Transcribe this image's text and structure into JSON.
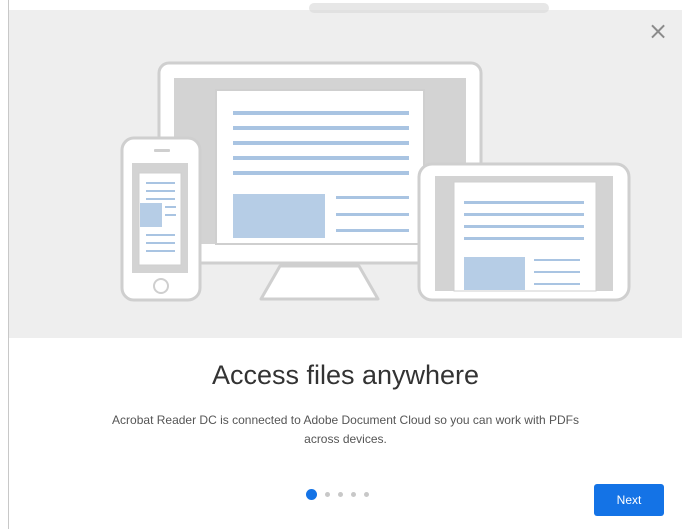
{
  "dialog": {
    "close_label": "×"
  },
  "content": {
    "title": "Access files anywhere",
    "description": "Acrobat Reader DC is connected to Adobe Document Cloud so you can work with PDFs across devices."
  },
  "pager": {
    "total_pages": 5,
    "current_page": 1
  },
  "actions": {
    "next_label": "Next"
  },
  "colors": {
    "accent": "#1473e6",
    "hero_background": "#eeeeee"
  },
  "icons": {
    "close": "close-icon",
    "illustration": "devices-illustration"
  }
}
